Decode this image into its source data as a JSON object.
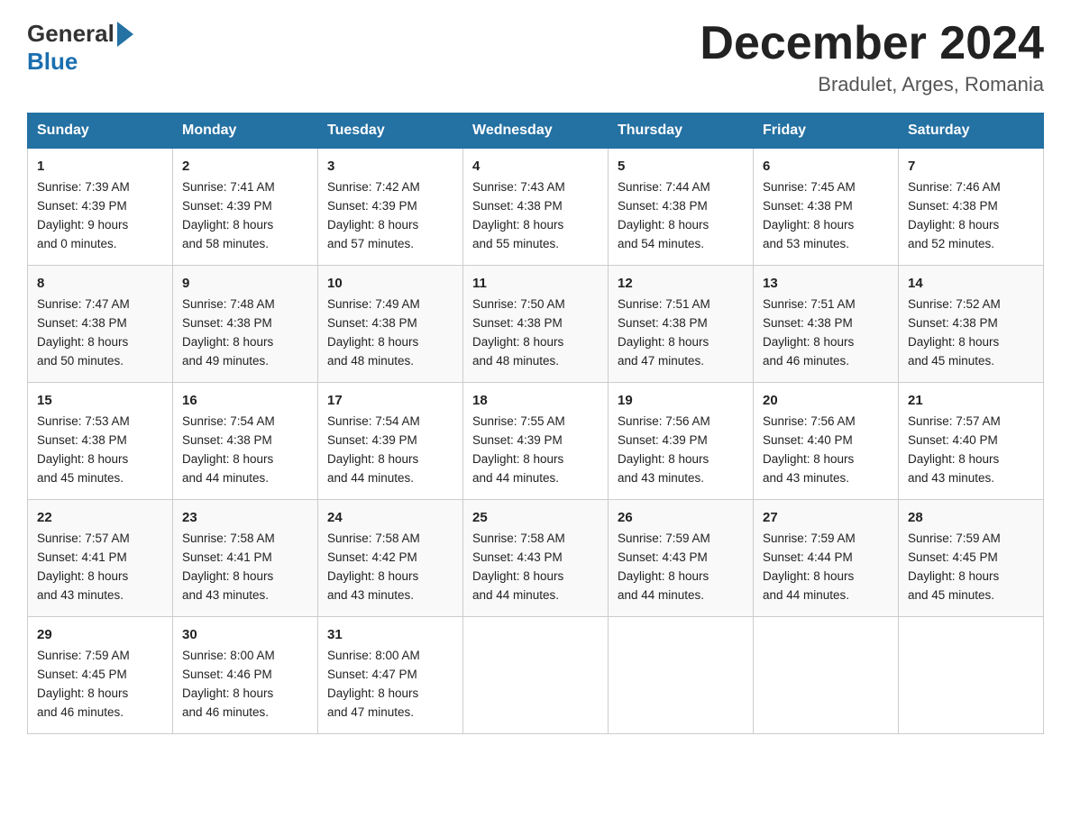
{
  "header": {
    "logo_general": "General",
    "logo_blue": "Blue",
    "main_title": "December 2024",
    "subtitle": "Bradulet, Arges, Romania"
  },
  "days_header": [
    "Sunday",
    "Monday",
    "Tuesday",
    "Wednesday",
    "Thursday",
    "Friday",
    "Saturday"
  ],
  "weeks": [
    [
      {
        "day": "1",
        "sunrise": "7:39 AM",
        "sunset": "4:39 PM",
        "daylight": "9 hours and 0 minutes."
      },
      {
        "day": "2",
        "sunrise": "7:41 AM",
        "sunset": "4:39 PM",
        "daylight": "8 hours and 58 minutes."
      },
      {
        "day": "3",
        "sunrise": "7:42 AM",
        "sunset": "4:39 PM",
        "daylight": "8 hours and 57 minutes."
      },
      {
        "day": "4",
        "sunrise": "7:43 AM",
        "sunset": "4:38 PM",
        "daylight": "8 hours and 55 minutes."
      },
      {
        "day": "5",
        "sunrise": "7:44 AM",
        "sunset": "4:38 PM",
        "daylight": "8 hours and 54 minutes."
      },
      {
        "day": "6",
        "sunrise": "7:45 AM",
        "sunset": "4:38 PM",
        "daylight": "8 hours and 53 minutes."
      },
      {
        "day": "7",
        "sunrise": "7:46 AM",
        "sunset": "4:38 PM",
        "daylight": "8 hours and 52 minutes."
      }
    ],
    [
      {
        "day": "8",
        "sunrise": "7:47 AM",
        "sunset": "4:38 PM",
        "daylight": "8 hours and 50 minutes."
      },
      {
        "day": "9",
        "sunrise": "7:48 AM",
        "sunset": "4:38 PM",
        "daylight": "8 hours and 49 minutes."
      },
      {
        "day": "10",
        "sunrise": "7:49 AM",
        "sunset": "4:38 PM",
        "daylight": "8 hours and 48 minutes."
      },
      {
        "day": "11",
        "sunrise": "7:50 AM",
        "sunset": "4:38 PM",
        "daylight": "8 hours and 48 minutes."
      },
      {
        "day": "12",
        "sunrise": "7:51 AM",
        "sunset": "4:38 PM",
        "daylight": "8 hours and 47 minutes."
      },
      {
        "day": "13",
        "sunrise": "7:51 AM",
        "sunset": "4:38 PM",
        "daylight": "8 hours and 46 minutes."
      },
      {
        "day": "14",
        "sunrise": "7:52 AM",
        "sunset": "4:38 PM",
        "daylight": "8 hours and 45 minutes."
      }
    ],
    [
      {
        "day": "15",
        "sunrise": "7:53 AM",
        "sunset": "4:38 PM",
        "daylight": "8 hours and 45 minutes."
      },
      {
        "day": "16",
        "sunrise": "7:54 AM",
        "sunset": "4:38 PM",
        "daylight": "8 hours and 44 minutes."
      },
      {
        "day": "17",
        "sunrise": "7:54 AM",
        "sunset": "4:39 PM",
        "daylight": "8 hours and 44 minutes."
      },
      {
        "day": "18",
        "sunrise": "7:55 AM",
        "sunset": "4:39 PM",
        "daylight": "8 hours and 44 minutes."
      },
      {
        "day": "19",
        "sunrise": "7:56 AM",
        "sunset": "4:39 PM",
        "daylight": "8 hours and 43 minutes."
      },
      {
        "day": "20",
        "sunrise": "7:56 AM",
        "sunset": "4:40 PM",
        "daylight": "8 hours and 43 minutes."
      },
      {
        "day": "21",
        "sunrise": "7:57 AM",
        "sunset": "4:40 PM",
        "daylight": "8 hours and 43 minutes."
      }
    ],
    [
      {
        "day": "22",
        "sunrise": "7:57 AM",
        "sunset": "4:41 PM",
        "daylight": "8 hours and 43 minutes."
      },
      {
        "day": "23",
        "sunrise": "7:58 AM",
        "sunset": "4:41 PM",
        "daylight": "8 hours and 43 minutes."
      },
      {
        "day": "24",
        "sunrise": "7:58 AM",
        "sunset": "4:42 PM",
        "daylight": "8 hours and 43 minutes."
      },
      {
        "day": "25",
        "sunrise": "7:58 AM",
        "sunset": "4:43 PM",
        "daylight": "8 hours and 44 minutes."
      },
      {
        "day": "26",
        "sunrise": "7:59 AM",
        "sunset": "4:43 PM",
        "daylight": "8 hours and 44 minutes."
      },
      {
        "day": "27",
        "sunrise": "7:59 AM",
        "sunset": "4:44 PM",
        "daylight": "8 hours and 44 minutes."
      },
      {
        "day": "28",
        "sunrise": "7:59 AM",
        "sunset": "4:45 PM",
        "daylight": "8 hours and 45 minutes."
      }
    ],
    [
      {
        "day": "29",
        "sunrise": "7:59 AM",
        "sunset": "4:45 PM",
        "daylight": "8 hours and 46 minutes."
      },
      {
        "day": "30",
        "sunrise": "8:00 AM",
        "sunset": "4:46 PM",
        "daylight": "8 hours and 46 minutes."
      },
      {
        "day": "31",
        "sunrise": "8:00 AM",
        "sunset": "4:47 PM",
        "daylight": "8 hours and 47 minutes."
      },
      null,
      null,
      null,
      null
    ]
  ],
  "labels": {
    "sunrise": "Sunrise:",
    "sunset": "Sunset:",
    "daylight": "Daylight:"
  }
}
